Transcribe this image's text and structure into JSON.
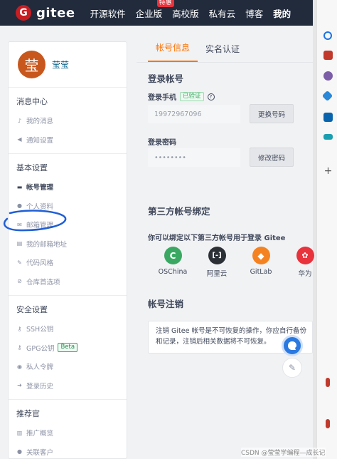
{
  "nav": {
    "logo_letter": "G",
    "logo_text": "gitee",
    "links": [
      "开源软件",
      "企业版",
      "高校版",
      "私有云",
      "博客",
      "我的"
    ],
    "hot_badge": "特惠"
  },
  "sidebar": {
    "avatar_char": "莹",
    "username": "莹莹",
    "sections": [
      {
        "title": "消息中心",
        "items": [
          "我的消息",
          "通知设置"
        ]
      },
      {
        "title": "基本设置",
        "items": [
          "帐号管理",
          "个人资料",
          "邮箱管理",
          "我的邮箱地址",
          "代码风格",
          "仓库首选项"
        ]
      },
      {
        "title": "安全设置",
        "items": [
          "SSH公钥",
          "GPG公钥",
          "私人令牌",
          "登录历史"
        ]
      },
      {
        "title": "推荐官",
        "items": [
          "推广概览",
          "关联客户"
        ]
      }
    ],
    "beta_badge": "Beta"
  },
  "main": {
    "tabs": [
      "帐号信息",
      "实名认证"
    ],
    "login_title": "登录帐号",
    "phone_label": "登录手机",
    "verified_badge": "已验证",
    "phone_value": "19972967096",
    "change_phone": "更换号码",
    "password_label": "登录密码",
    "password_value": "••••••••",
    "change_password": "修改密码",
    "third_title": "第三方帐号绑定",
    "third_desc": "你可以绑定以下第三方帐号用于登录 Gitee",
    "providers": [
      "OSChina",
      "阿里云",
      "GitLab",
      "华为"
    ],
    "cancel_title": "帐号注销",
    "cancel_line1": "注销 Gitee 帐号是不可恢复的操作，你应自行备份",
    "cancel_line2": "和记录，注销后相关数据将不可恢复。"
  },
  "watermark": "CSDN @莹莹学编程—成长记",
  "colors": {
    "accent": "#fe7300",
    "nav_bg": "#212b3c",
    "brand_red": "#c71d23",
    "annotation_blue": "#1f5fd6"
  }
}
